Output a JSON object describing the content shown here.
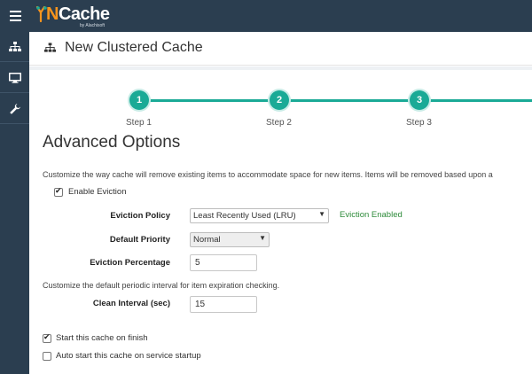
{
  "app": {
    "brand_prefix": "N",
    "brand_name": "Cache",
    "brand_sub": "by Alachisoft"
  },
  "header": {
    "title": "New Clustered Cache"
  },
  "sidebar": {
    "items": [
      {
        "icon": "cluster-icon"
      },
      {
        "icon": "monitor-icon"
      },
      {
        "icon": "wrench-icon"
      }
    ]
  },
  "stepper": {
    "steps": [
      {
        "number": "1",
        "label": "Step 1"
      },
      {
        "number": "2",
        "label": "Step 2"
      },
      {
        "number": "3",
        "label": "Step 3"
      }
    ]
  },
  "form": {
    "section_title": "Advanced Options",
    "eviction_description": "Customize the way cache will remove existing items to accommodate space for new items. Items will be removed based upon a",
    "enable_eviction_label": "Enable Eviction",
    "enable_eviction_checked": true,
    "eviction_policy_label": "Eviction Policy",
    "eviction_policy_value": "Least Recently Used (LRU)",
    "eviction_status": "Eviction Enabled",
    "default_priority_label": "Default Priority",
    "default_priority_value": "Normal",
    "eviction_percentage_label": "Eviction Percentage",
    "eviction_percentage_value": "5",
    "interval_description": "Customize the default periodic interval for item expiration checking.",
    "clean_interval_label": "Clean Interval (sec)",
    "clean_interval_value": "15",
    "start_on_finish_label": "Start this cache on finish",
    "start_on_finish_checked": true,
    "auto_start_label": "Auto start this cache on service startup",
    "auto_start_checked": false
  },
  "colors": {
    "topbar": "#2b3e50",
    "accent": "#1aaa96",
    "status_ok": "#2e8b3a"
  }
}
